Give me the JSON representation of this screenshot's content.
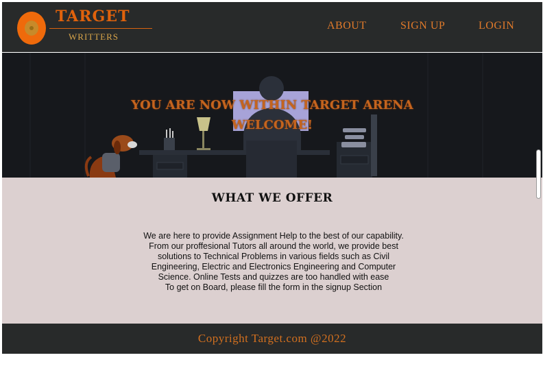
{
  "header": {
    "brand_name": "TARGET",
    "brand_sub": "WRITTERS",
    "nav": [
      {
        "label": "ABOUT"
      },
      {
        "label": "SIGN UP"
      },
      {
        "label": "LOGIN"
      }
    ]
  },
  "hero": {
    "line1": "YOU ARE NOW WITHIN TARGET ARENA",
    "line2": "WELCOME!"
  },
  "offer": {
    "title": "WHAT WE OFFER",
    "lines": [
      "We are here to provide Assignment Help to the best of our capability.",
      "From our proffesional Tutors all around the world, we provide best solutions to Technical Problems in various fields such as Civil Engineering, Electric and Electronics Engineering and Computer Science. Online Tests and quizzes are too handled with ease",
      "To get on Board, please fill the form in the signup Section"
    ]
  },
  "footer": {
    "copyright": "Copyright Target.com @2022"
  },
  "colors": {
    "header_bg": "#282a2a",
    "accent_orange": "#e0620c",
    "hero_bg": "#15171b",
    "offer_bg": "#dcd0d0",
    "footer_bg": "#282a2a"
  },
  "icons": {
    "logo": "target-logo-icon"
  }
}
